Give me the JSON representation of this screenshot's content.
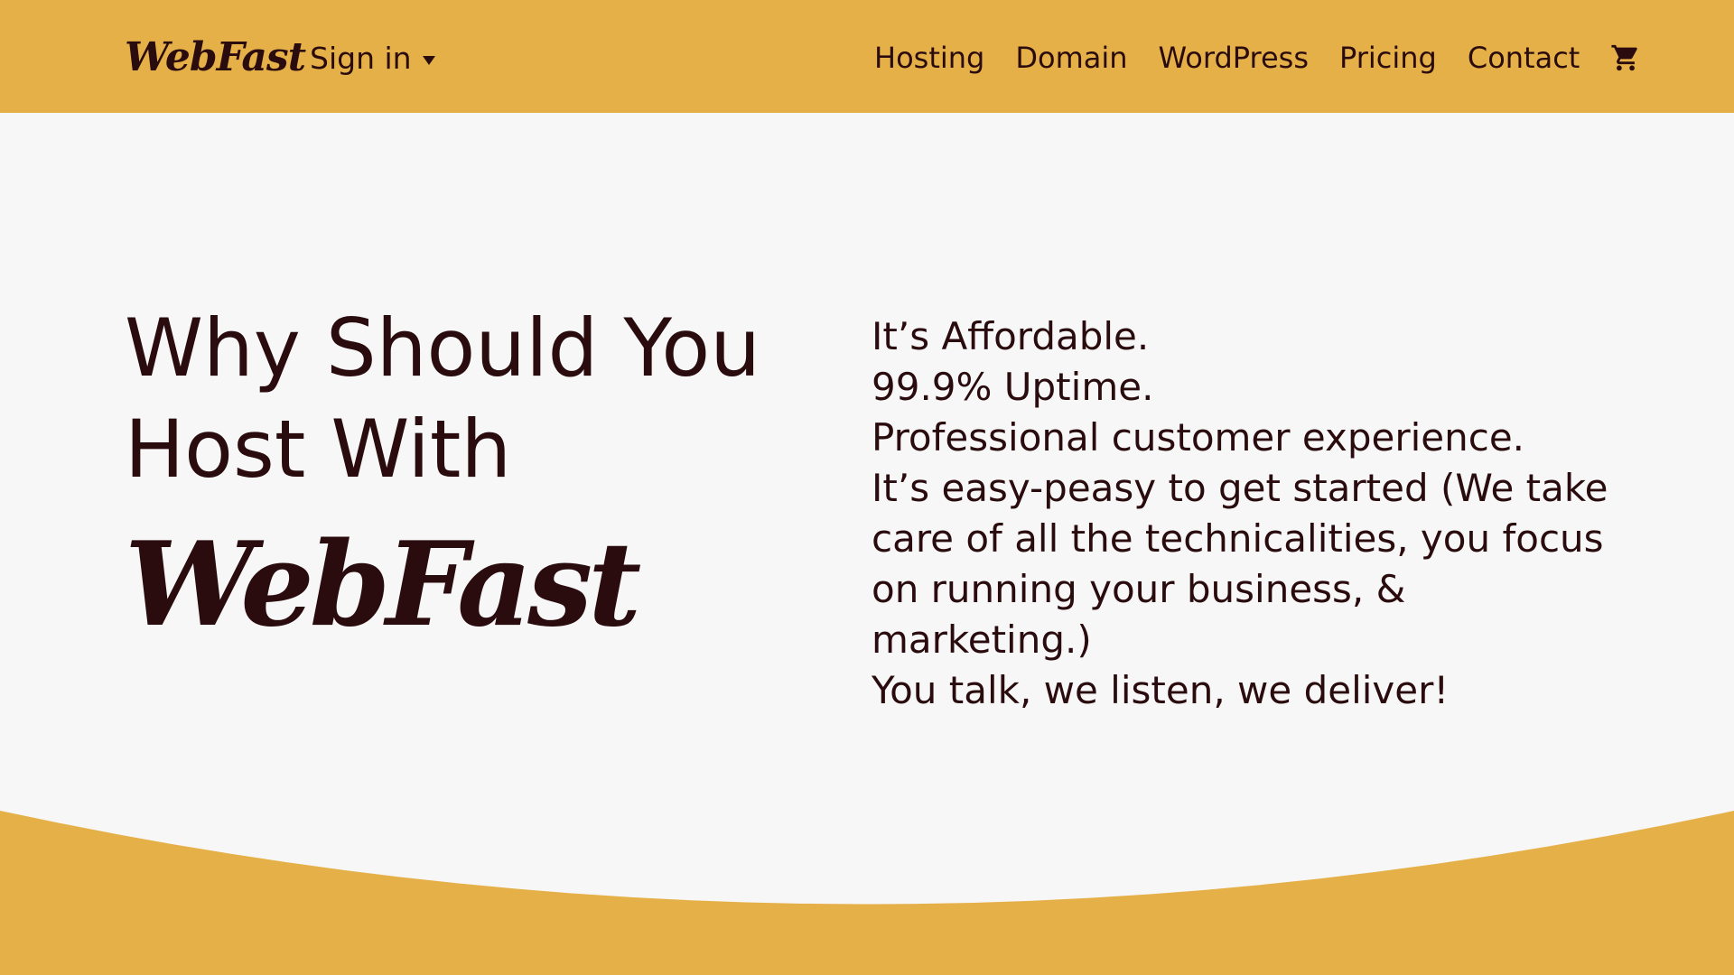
{
  "header": {
    "logo_text": "WebFast",
    "signin_label": "Sign in",
    "nav": [
      {
        "label": "Hosting"
      },
      {
        "label": "Domain"
      },
      {
        "label": "WordPress"
      },
      {
        "label": "Pricing"
      },
      {
        "label": "Contact"
      }
    ],
    "cart_icon": "shopping-cart-icon",
    "caret_icon": "caret-down-icon"
  },
  "hero": {
    "headline_line1": "Why Should You",
    "headline_line2": "Host With",
    "brand": "WebFast",
    "reasons": [
      "It’s Affordable.",
      "99.9% Uptime.",
      "Professional customer experience.",
      "It’s easy-peasy to get started (We take care of all the technicalities, you focus on running your business, & marketing.)",
      "You talk, we listen, we deliver!"
    ]
  },
  "colors": {
    "accent": "#e6b049",
    "background": "#f7f7f8",
    "text": "#2a0c0e"
  }
}
